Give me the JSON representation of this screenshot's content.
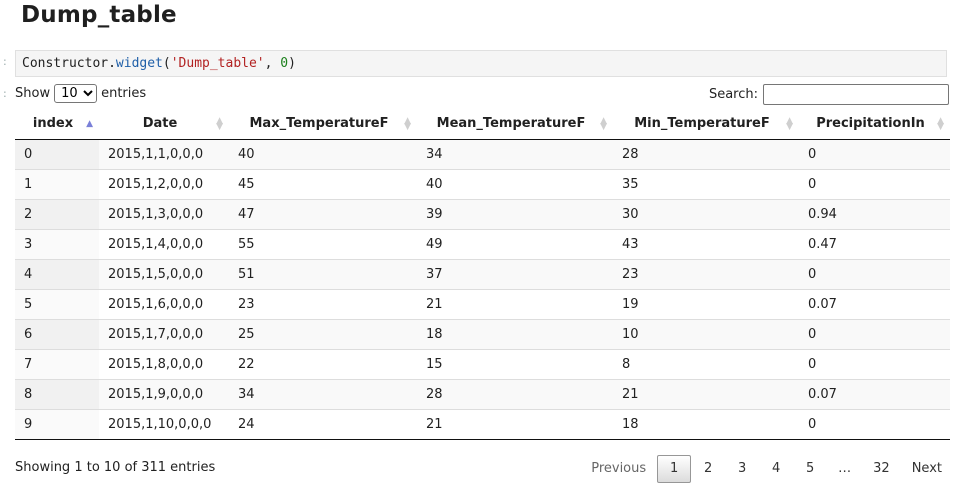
{
  "page_title": "Dump_table",
  "code": {
    "obj": "Constructor",
    "dot": ".",
    "method": "widget",
    "open": "(",
    "arg_str": "'Dump_table'",
    "comma": ", ",
    "arg_num": "0",
    "close": ")"
  },
  "length": {
    "prefix": "Show",
    "selected": "10",
    "suffix": "entries"
  },
  "search": {
    "label": "Search:",
    "value": "",
    "placeholder": ""
  },
  "columns": [
    "index",
    "Date",
    "Max_TemperatureF",
    "Mean_TemperatureF",
    "Min_TemperatureF",
    "PrecipitationIn"
  ],
  "sort": {
    "column": "index",
    "direction": "ascending"
  },
  "rows": [
    [
      "0",
      "2015,1,1,0,0,0",
      "40",
      "34",
      "28",
      "0"
    ],
    [
      "1",
      "2015,1,2,0,0,0",
      "45",
      "40",
      "35",
      "0"
    ],
    [
      "2",
      "2015,1,3,0,0,0",
      "47",
      "39",
      "30",
      "0.94"
    ],
    [
      "3",
      "2015,1,4,0,0,0",
      "55",
      "49",
      "43",
      "0.47"
    ],
    [
      "4",
      "2015,1,5,0,0,0",
      "51",
      "37",
      "23",
      "0"
    ],
    [
      "5",
      "2015,1,6,0,0,0",
      "23",
      "21",
      "19",
      "0.07"
    ],
    [
      "6",
      "2015,1,7,0,0,0",
      "25",
      "18",
      "10",
      "0"
    ],
    [
      "7",
      "2015,1,8,0,0,0",
      "22",
      "15",
      "8",
      "0"
    ],
    [
      "8",
      "2015,1,9,0,0,0",
      "34",
      "28",
      "21",
      "0.07"
    ],
    [
      "9",
      "2015,1,10,0,0,0",
      "24",
      "21",
      "18",
      "0"
    ]
  ],
  "info": "Showing 1 to 10 of 311 entries",
  "pagination": {
    "previous": "Previous",
    "pages": [
      "1",
      "2",
      "3",
      "4",
      "5",
      "…",
      "32"
    ],
    "current": "1",
    "next": "Next"
  },
  "colors": {
    "sort_active": "#7a80d8",
    "sort_inactive": "#cfcfcf"
  }
}
